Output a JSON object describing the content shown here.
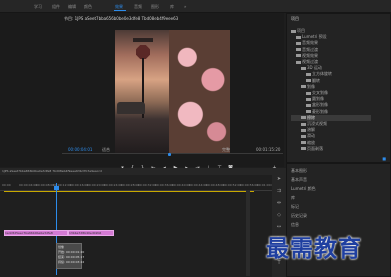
{
  "workspace_tabs": [
    "学习",
    "组件",
    "编辑",
    "颜色",
    "效果",
    "音频",
    "图形",
    "库",
    "»"
  ],
  "active_workspace_index": 4,
  "program_monitor": {
    "tab_label": "节目: 1JPS aSeet7bba656b0be0e3dfe8 Tbd08eb4f9eee63",
    "sequence_label": "13bbe7d8b40ed02-b6T1eb03e6a2eb0e7e06c7beb9a",
    "timecode_left": "00:00:04:01",
    "fit": "适合",
    "quality": "完整",
    "timecode_right": "00:01:15:20"
  },
  "transport_icons": [
    "marker-icon",
    "in-point-icon",
    "out-point-icon",
    "go-to-in-icon",
    "step-back-icon",
    "play-icon",
    "step-forward-icon",
    "go-to-out-icon",
    "lift-icon",
    "extract-icon",
    "export-frame-icon",
    "plus-icon"
  ],
  "project_panel": {
    "title": "项目",
    "items": [
      {
        "label": "项目",
        "indent": 0
      },
      {
        "label": "Lumetri 预设",
        "indent": 1
      },
      {
        "label": "音频效果",
        "indent": 1
      },
      {
        "label": "音频过渡",
        "indent": 1
      },
      {
        "label": "视频效果",
        "indent": 1
      },
      {
        "label": "视频过渡",
        "indent": 1
      },
      {
        "label": "3D 运动",
        "indent": 2
      },
      {
        "label": "立方体旋转",
        "indent": 3
      },
      {
        "label": "翻转",
        "indent": 3
      },
      {
        "label": "划像",
        "indent": 2
      },
      {
        "label": "交叉划像",
        "indent": 3
      },
      {
        "label": "圆划像",
        "indent": 3
      },
      {
        "label": "盒形划像",
        "indent": 3
      },
      {
        "label": "菱形划像",
        "indent": 3
      },
      {
        "label": "擦除",
        "indent": 2,
        "selected": true
      },
      {
        "label": "沉浸式视频",
        "indent": 2
      },
      {
        "label": "溶解",
        "indent": 2
      },
      {
        "label": "滑动",
        "indent": 2
      },
      {
        "label": "缩放",
        "indent": 2
      },
      {
        "label": "页面剥落",
        "indent": 2
      }
    ]
  },
  "right_lower_panel": {
    "items": [
      "基本图形",
      "基本声音",
      "Lumetri 颜色",
      "库",
      "标记",
      "历史记录",
      "信息"
    ]
  },
  "timeline": {
    "ruler_labels": [
      "00:00",
      "00:00:04:00",
      "00:00:08:00",
      "00:00:12:00",
      "00:00:16:00",
      "00:00:20:00",
      "00:00:24:00",
      "00:00:28:00",
      "00:00:32:00",
      "00:00:36:00",
      "00:00:40:00",
      "00:00:44:00",
      "00:00:48:00",
      "00:00:52:00",
      "00:00:56:00",
      "00:01:00:00"
    ],
    "header_label": "1JPS aSeet7bba656b0be0e3dfe8 7bd08eb4f9eee63bd7b7e9eaccd",
    "clips": [
      {
        "label": "1edc8d5eec7ba66b0be0e3dfe8"
      },
      {
        "label": "13bbe7d8b40ed02b6"
      }
    ],
    "tooltip": [
      "划像",
      "开始: 00:00:01:20",
      "结束: 00:00:05:17",
      "持续: 00:00:03:22"
    ]
  },
  "watermark": "最需教育"
}
